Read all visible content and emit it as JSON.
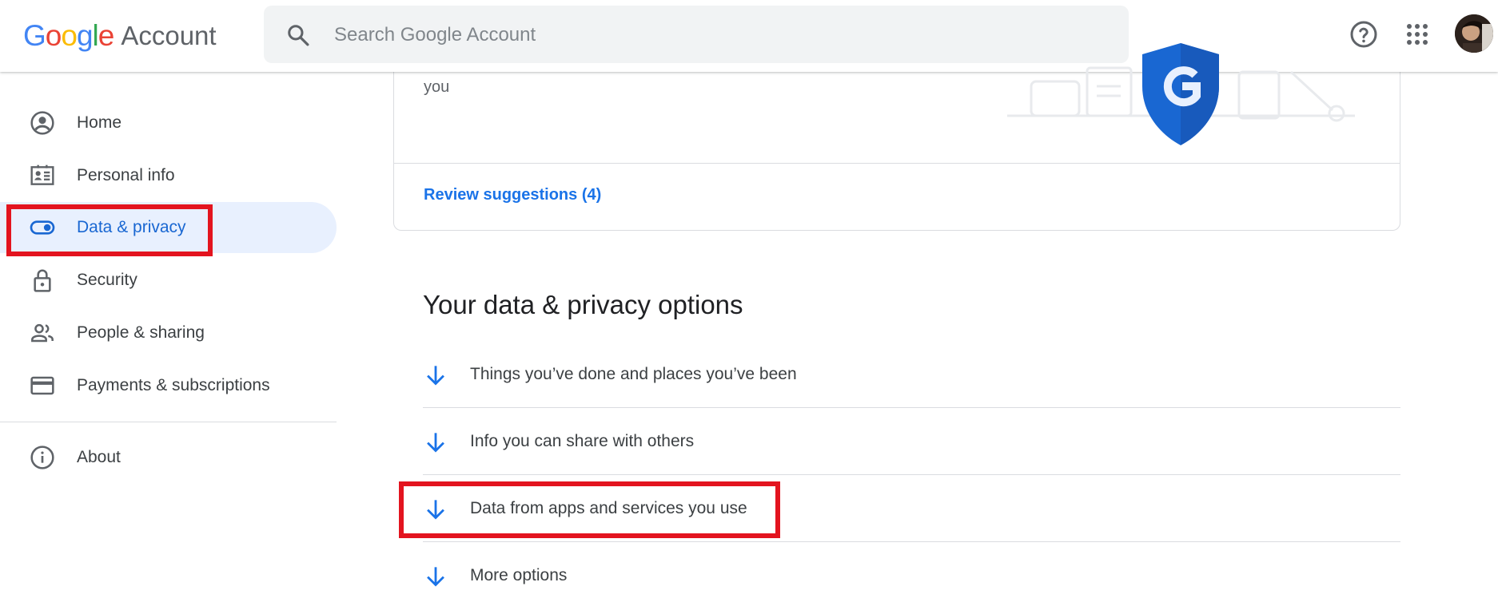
{
  "header": {
    "logo_letters": [
      "G",
      "o",
      "o",
      "g",
      "l",
      "e"
    ],
    "logo_suffix": "Account",
    "search_placeholder": "Search Google Account",
    "help_icon": "help-circle-icon",
    "apps_icon": "apps-grid-icon",
    "avatar_icon": "user-avatar"
  },
  "sidebar": {
    "items": [
      {
        "label": "Home",
        "icon": "account-circle-icon"
      },
      {
        "label": "Personal info",
        "icon": "id-card-icon"
      },
      {
        "label": "Data & privacy",
        "icon": "toggle-icon",
        "active": true
      },
      {
        "label": "Security",
        "icon": "lock-icon"
      },
      {
        "label": "People & sharing",
        "icon": "people-icon"
      },
      {
        "label": "Payments & subscriptions",
        "icon": "credit-card-icon"
      },
      {
        "label": "About",
        "icon": "info-icon"
      }
    ]
  },
  "card": {
    "partial_text": "you",
    "review_link": "Review suggestions (4)",
    "illustration_icon": "google-shield-icon"
  },
  "section": {
    "title": "Your data & privacy options",
    "options": [
      {
        "label": "Things you’ve done and places you’ve been",
        "icon": "arrow-down-icon"
      },
      {
        "label": "Info you can share with others",
        "icon": "arrow-down-icon"
      },
      {
        "label": "Data from apps and services you use",
        "icon": "arrow-down-icon",
        "highlighted": true
      },
      {
        "label": "More options",
        "icon": "arrow-down-icon"
      }
    ]
  },
  "colors": {
    "accent_blue": "#1a73e8",
    "active_bg": "#e8f0fe",
    "highlight_red": "#e3141f",
    "divider": "#dadce0"
  }
}
